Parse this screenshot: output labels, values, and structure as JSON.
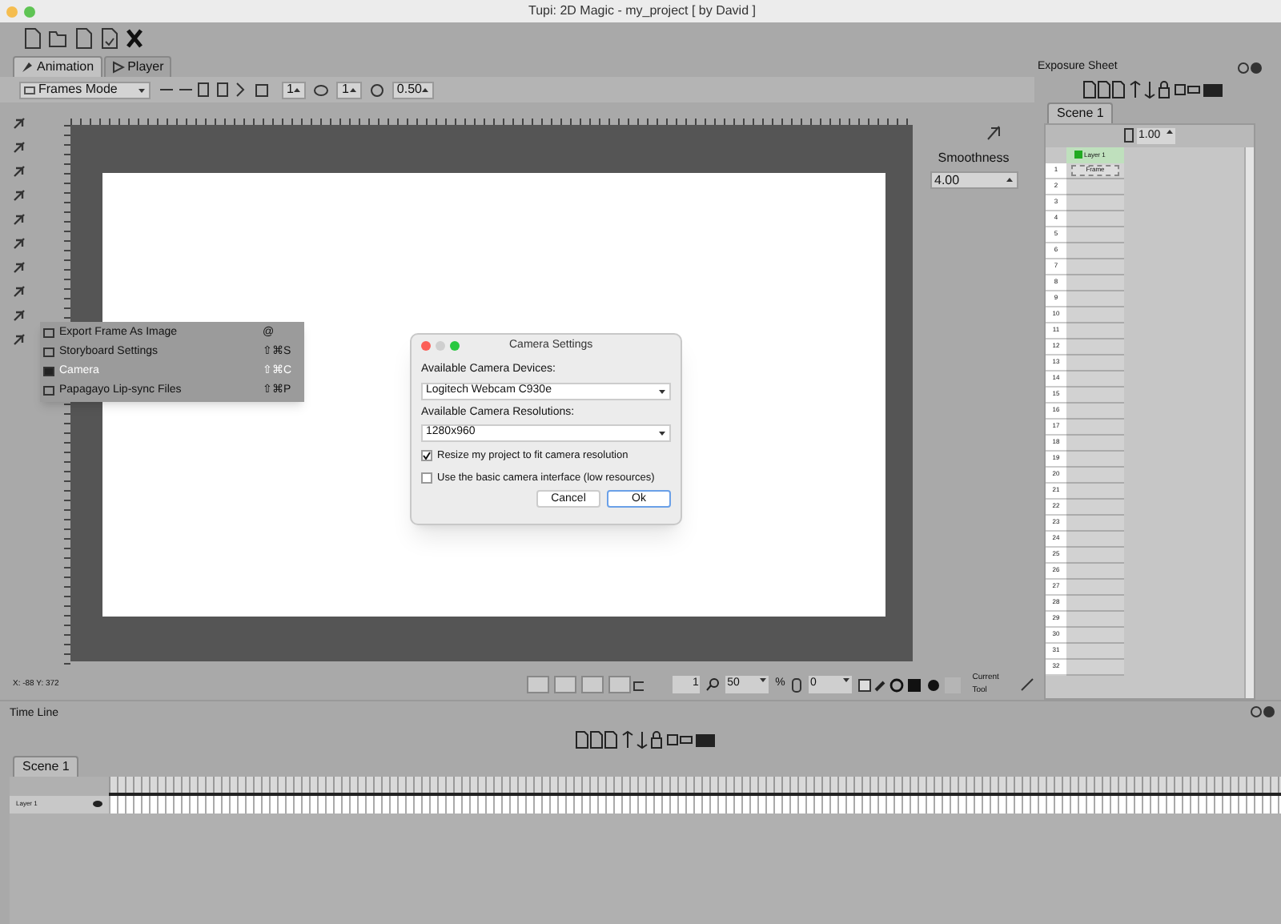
{
  "window": {
    "title": "Tupi: 2D Magic - my_project [ by David ]"
  },
  "tabs": [
    {
      "label": "Animation",
      "selected": true
    },
    {
      "label": "Player",
      "selected": false
    }
  ],
  "tool_options": {
    "mode": "Frames Mode",
    "spin_1": "1",
    "spin_2": "1",
    "opacity": "0.50"
  },
  "smoothness": {
    "label": "Smoothness",
    "value": "4.00"
  },
  "menu": {
    "items": [
      {
        "label": "Export Frame As Image",
        "shortcut": "@",
        "selected": false
      },
      {
        "label": "Storyboard Settings",
        "shortcut": "⇧⌘S",
        "selected": false
      },
      {
        "label": "Camera",
        "shortcut": "⇧⌘C",
        "selected": true
      },
      {
        "label": "Papagayo Lip-sync Files",
        "shortcut": "⇧⌘P",
        "selected": false
      }
    ]
  },
  "dialog": {
    "title": "Camera Settings",
    "devices_label": "Available Camera Devices:",
    "device": "Logitech Webcam C930e",
    "resolutions_label": "Available Camera Resolutions:",
    "resolution": "1280x960",
    "options": [
      {
        "label": "Resize my project to fit camera resolution",
        "checked": true
      },
      {
        "label": "Use the basic camera interface (low resources)",
        "checked": false
      }
    ],
    "buttons": [
      {
        "label": "Cancel",
        "default": false
      },
      {
        "label": "Ok",
        "default": true
      }
    ]
  },
  "status_bar": {
    "coords": "X: -88 Y: 372",
    "frame": "1",
    "zoom": "50",
    "zoom_unit": "%",
    "rotation": "0",
    "current_tool_label": "Current Tool"
  },
  "exposure_sheet": {
    "title": "Exposure Sheet",
    "scene_tab": "Scene 1",
    "fps": "1.00",
    "layer": {
      "label": "Layer 1",
      "color": "#22aa22"
    },
    "first_cell": "Frame",
    "rows": [
      "1",
      "2",
      "3",
      "4",
      "5",
      "6",
      "7",
      "8",
      "9",
      "10",
      "11",
      "12",
      "13",
      "14",
      "15",
      "16",
      "17",
      "18",
      "19",
      "20",
      "21",
      "22",
      "23",
      "24",
      "25",
      "26",
      "27",
      "28",
      "29",
      "30",
      "31",
      "32"
    ]
  },
  "timeline": {
    "title": "Time Line",
    "scene_tab": "Scene 1",
    "layer": "Layer 1"
  }
}
